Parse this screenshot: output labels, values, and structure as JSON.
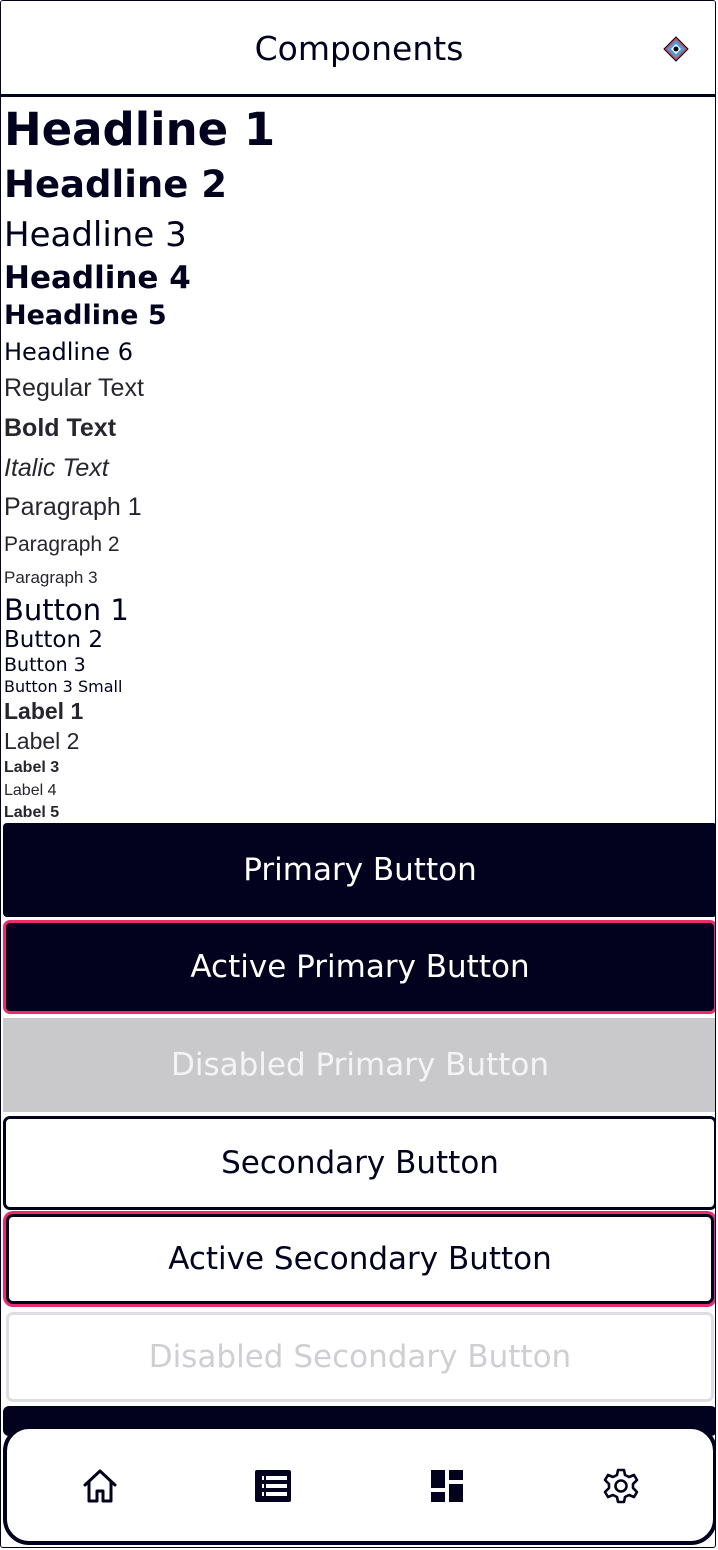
{
  "header": {
    "title": "Components",
    "icon": "app-logo-icon"
  },
  "typography": {
    "headline_1": "Headline 1",
    "headline_2": "Headline 2",
    "headline_3": "Headline 3",
    "headline_4": "Headline 4",
    "headline_5": "Headline 5",
    "headline_6": "Headline 6",
    "regular_text": "Regular Text",
    "bold_text": "Bold Text",
    "italic_text": "Italic Text",
    "paragraph_1": "Paragraph 1",
    "paragraph_2": "Paragraph 2",
    "paragraph_3": "Paragraph 3",
    "button_1": "Button 1",
    "button_2": "Button 2",
    "button_3": "Button 3",
    "button_3_small": "Button 3 Small",
    "label_1": "Label 1",
    "label_2": "Label 2",
    "label_3": "Label 3",
    "label_4": "Label 4",
    "label_5": "Label 5"
  },
  "buttons": {
    "primary": "Primary Button",
    "active_primary": "Active Primary Button",
    "disabled_primary": "Disabled Primary Button",
    "secondary": "Secondary Button",
    "active_secondary": "Active Secondary Button",
    "disabled_secondary": "Disabled Secondary Button"
  },
  "bottom_nav": {
    "items": [
      {
        "icon": "home-icon"
      },
      {
        "icon": "list-icon"
      },
      {
        "icon": "dashboard-icon"
      },
      {
        "icon": "settings-gear-icon"
      }
    ]
  },
  "colors": {
    "primary": "#02021e",
    "accent": "#ea2d6a",
    "disabled_bg": "#c9c9cc",
    "disabled_text": "#f4f4f6",
    "disabled_border": "#dedee2"
  }
}
